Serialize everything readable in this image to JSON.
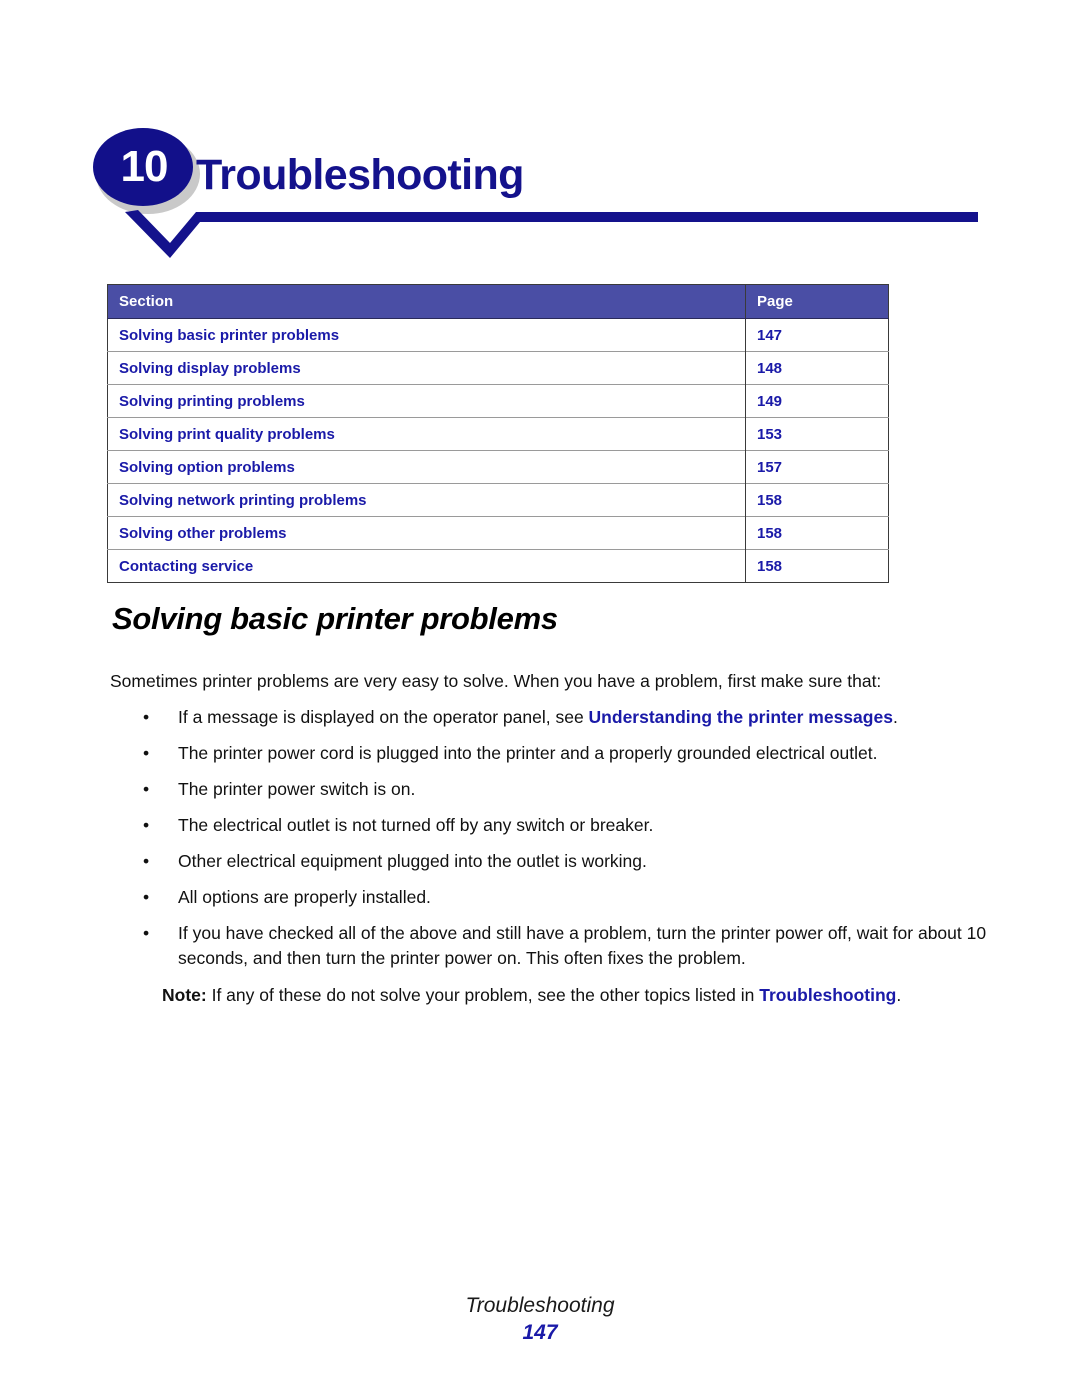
{
  "header": {
    "chapter_number": "10",
    "chapter_title": "Troubleshooting",
    "badge_color": "#12108a",
    "badge_shadow_color": "#c9c9c9",
    "rule_color": "#14128c",
    "title_color": "#14128c"
  },
  "section_table": {
    "columns": [
      "Section",
      "Page"
    ],
    "header_bg": "#4a4ea5",
    "header_text_color": "#ffffff",
    "link_color": "#1a1aa8",
    "rows": [
      {
        "section": "Solving basic printer problems",
        "page": "147"
      },
      {
        "section": "Solving display problems",
        "page": "148"
      },
      {
        "section": "Solving printing problems",
        "page": "149"
      },
      {
        "section": "Solving print quality problems",
        "page": "153"
      },
      {
        "section": "Solving option problems",
        "page": "157"
      },
      {
        "section": "Solving network printing problems",
        "page": "158"
      },
      {
        "section": "Solving other problems",
        "page": "158"
      },
      {
        "section": "Contacting service",
        "page": "158"
      }
    ]
  },
  "body": {
    "heading": "Solving basic printer problems",
    "intro": "Sometimes printer problems are very easy to solve. When you have a problem, first make sure that:",
    "bullet_marker": "•",
    "bullets": [
      {
        "text_before": "If a message is displayed on the operator panel, see ",
        "link": "Understanding the printer messages",
        "text_after": "."
      },
      {
        "text_before": "The printer power cord is plugged into the printer and a properly grounded electrical outlet.",
        "link": "",
        "text_after": ""
      },
      {
        "text_before": "The printer power switch is on.",
        "link": "",
        "text_after": ""
      },
      {
        "text_before": "The electrical outlet is not turned off by any switch or breaker.",
        "link": "",
        "text_after": ""
      },
      {
        "text_before": "Other electrical equipment plugged into the outlet is working.",
        "link": "",
        "text_after": ""
      },
      {
        "text_before": "All options are properly installed.",
        "link": "",
        "text_after": ""
      },
      {
        "text_before": "If you have checked all of the above and still have a problem, turn the printer power off, wait for about 10 seconds, and then turn the printer power on. This often fixes the problem.",
        "link": "",
        "text_after": ""
      }
    ],
    "note": {
      "label": "Note:",
      "text_before": " If any of these do not solve your problem, see the other topics listed in ",
      "link": "Troubleshooting",
      "text_after": "."
    }
  },
  "footer": {
    "title": "Troubleshooting",
    "page_number": "147"
  }
}
